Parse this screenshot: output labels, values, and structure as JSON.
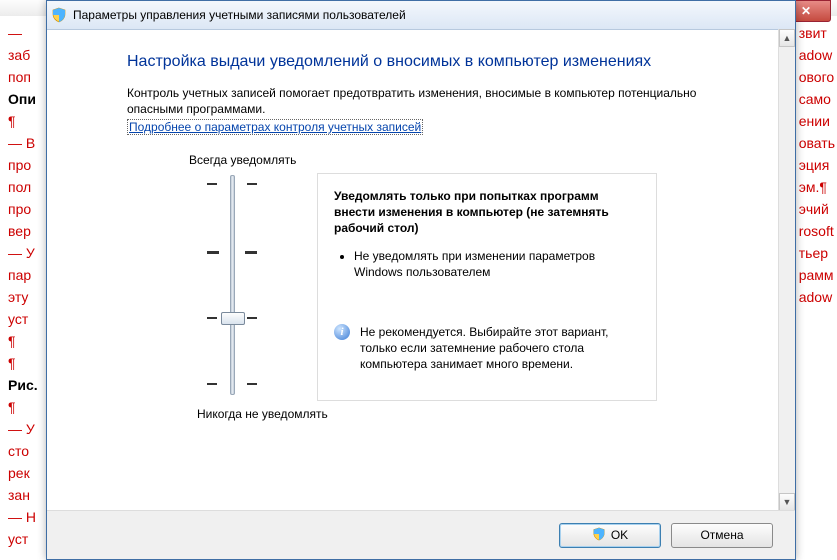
{
  "bg": {
    "l1": "—",
    "l2": "заб",
    "l3": "поп",
    "l4": "Опи",
    "l5": "¶",
    "l6": "— В",
    "l7": "про",
    "l8": "пол",
    "l9": "про",
    "l10": "вер",
    "l11": "— У",
    "l12": "пар",
    "l13": "эту",
    "l14": "уст",
    "l15": "¶",
    "l16": "¶",
    "l17": "Рис.",
    "l18": "¶",
    "l19": "— У",
    "l20": "сто",
    "l21": "рек",
    "l22": "зан",
    "l23": "— Н",
    "l24": "уст",
    "r1": "",
    "r2": "",
    "r3": "",
    "r4": "",
    "r5": "",
    "r6": "звит",
    "r7": "adow",
    "r8": "ового",
    "r9": "само",
    "r10": "",
    "r11": "ении",
    "r12": "овать",
    "r13": "эция",
    "r14": "эм.¶",
    "r15": "",
    "r16": "",
    "r17": "",
    "r18": "",
    "r19": "эчий",
    "r20": "rosoft",
    "r21": "тьер",
    "r22": "",
    "r23": "рамм",
    "r24": "adow"
  },
  "titlebar": {
    "text": "Параметры управления учетными записями пользователей"
  },
  "heading": "Настройка выдачи уведомлений о вносимых в компьютер изменениях",
  "desc": "Контроль учетных записей помогает предотвратить изменения, вносимые в компьютер потенциально опасными программами.",
  "link": "Подробнее о параметрах контроля учетных записей",
  "slider": {
    "top": "Всегда уведомлять",
    "bottom": "Никогда не уведомлять",
    "level_index": 2,
    "levels": 4
  },
  "info": {
    "title": "Уведомлять только при попытках программ внести изменения в компьютер (не затемнять рабочий стол)",
    "bullet1": "Не уведомлять при изменении параметров Windows пользователем",
    "note": "Не рекомендуется. Выбирайте этот вариант, только если затемнение рабочего стола компьютера занимает много времени."
  },
  "buttons": {
    "ok": "OK",
    "cancel": "Отмена"
  }
}
